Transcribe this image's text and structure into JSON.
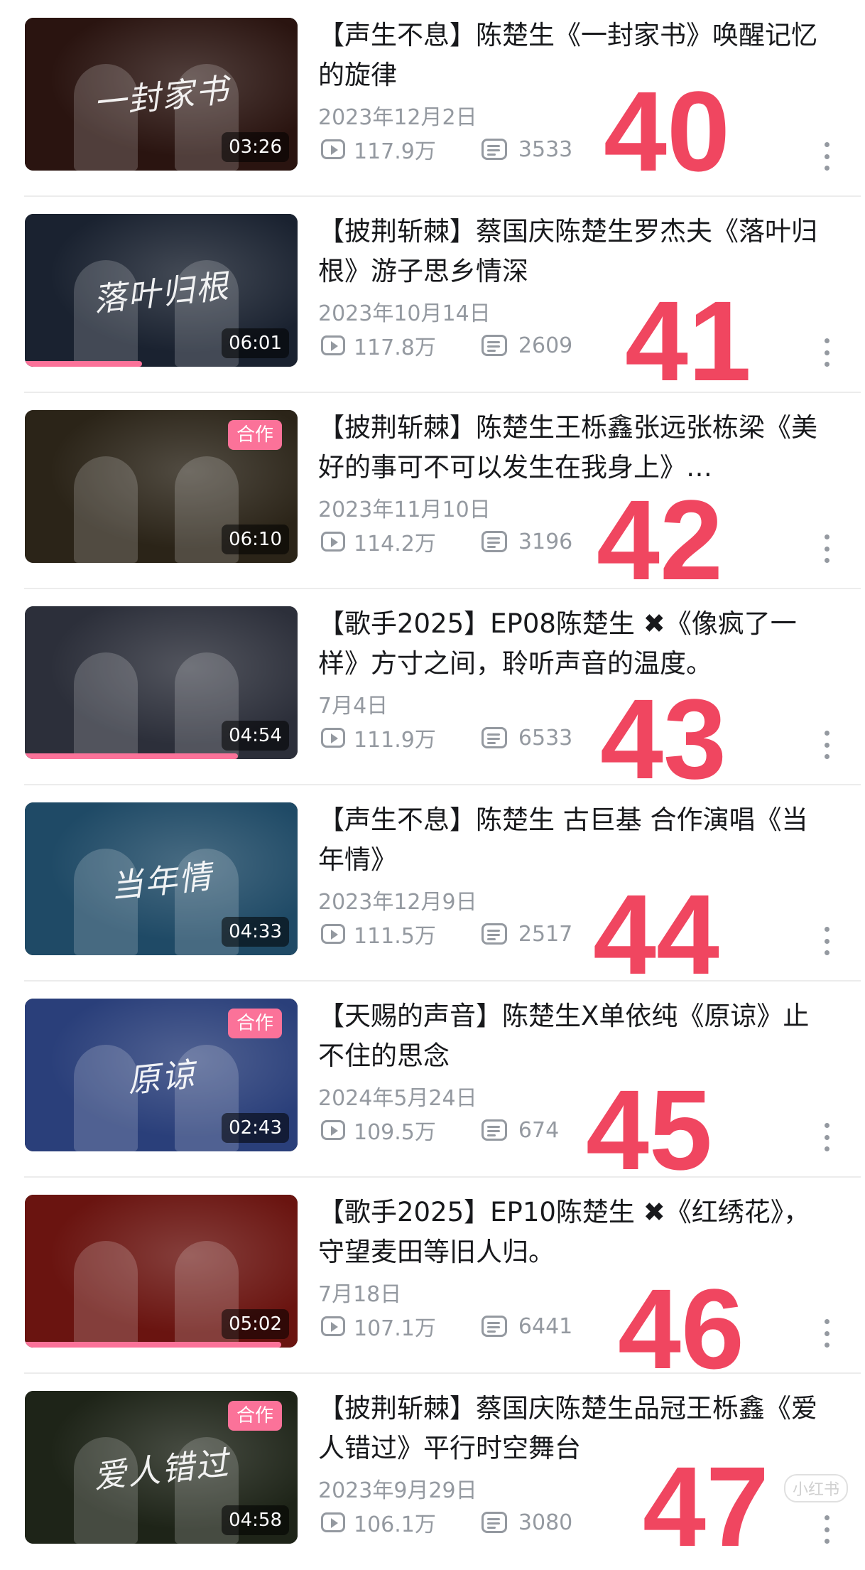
{
  "items": [
    {
      "title": "【声生不息】陈楚生《一封家书》唤醒记忆的旋律",
      "date": "2023年12月2日",
      "views": "117.9万",
      "danmaku": "3533",
      "duration": "03:26",
      "rank": "40",
      "thumb_text": "一封家书",
      "collab": ""
    },
    {
      "title": "【披荆斩棘】蔡国庆陈楚生罗杰夫《落叶归根》游子思乡情深",
      "date": "2023年10月14日",
      "views": "117.8万",
      "danmaku": "2609",
      "duration": "06:01",
      "rank": "41",
      "thumb_text": "落叶归根",
      "collab": ""
    },
    {
      "title": "【披荆斩棘】陈楚生王栎鑫张远张栋梁《美好的事可不可以发生在我身上》…",
      "date": "2023年11月10日",
      "views": "114.2万",
      "danmaku": "3196",
      "duration": "06:10",
      "rank": "42",
      "thumb_text": "",
      "collab": "合作"
    },
    {
      "title": "【歌手2025】EP08陈楚生 ✖《像疯了一样》方寸之间，聆听声音的温度。",
      "date": "7月4日",
      "views": "111.9万",
      "danmaku": "6533",
      "duration": "04:54",
      "rank": "43",
      "thumb_text": "",
      "collab": ""
    },
    {
      "title": "【声生不息】陈楚生 古巨基 合作演唱《当年情》",
      "date": "2023年12月9日",
      "views": "111.5万",
      "danmaku": "2517",
      "duration": "04:33",
      "rank": "44",
      "thumb_text": "当年情",
      "collab": ""
    },
    {
      "title": "【天赐的声音】陈楚生X单依纯《原谅》止不住的思念",
      "date": "2024年5月24日",
      "views": "109.5万",
      "danmaku": "674",
      "duration": "02:43",
      "rank": "45",
      "thumb_text": "原谅",
      "collab": "合作"
    },
    {
      "title": "【歌手2025】EP10陈楚生 ✖《红绣花》，守望麦田等旧人归。",
      "date": "7月18日",
      "views": "107.1万",
      "danmaku": "6441",
      "duration": "05:02",
      "rank": "46",
      "thumb_text": "",
      "collab": ""
    },
    {
      "title": "【披荆斩棘】蔡国庆陈楚生品冠王栎鑫《爱人错过》平行时空舞台",
      "date": "2023年9月29日",
      "views": "106.1万",
      "danmaku": "3080",
      "duration": "04:58",
      "rank": "47",
      "thumb_text": "爱人错过",
      "collab": "合作"
    }
  ],
  "progress": [
    0,
    0.43,
    0,
    0.78,
    0,
    0,
    0.94,
    0
  ],
  "thumb_colors": [
    "#2a1410",
    "#1a2230",
    "#2b2418",
    "#2c2f3a",
    "#1f4a66",
    "#2a3f7a",
    "#6a1410",
    "#1e2418"
  ],
  "rank_color": "#f04660",
  "accent_color": "#fb7299",
  "watermark": "小红书",
  "icons": {
    "views": "play-count-icon",
    "danmaku": "danmaku-icon",
    "more": "more-vertical-icon"
  }
}
